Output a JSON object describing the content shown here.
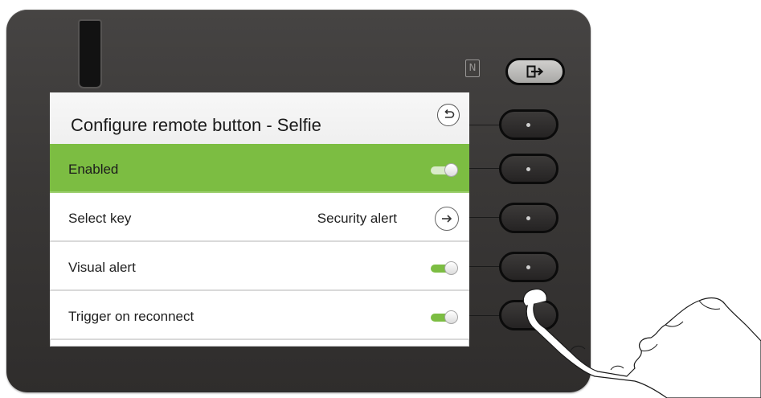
{
  "device": {
    "nfc_icon": "nfc-icon",
    "logout_icon": "logout-icon"
  },
  "screen": {
    "title": "Configure remote button - Selfie",
    "back_icon": "back-arrow-icon",
    "rows": [
      {
        "label": "Enabled",
        "type": "toggle",
        "on": true,
        "focused": true
      },
      {
        "label": "Select key",
        "type": "link",
        "value": "Security alert"
      },
      {
        "label": "Visual alert",
        "type": "toggle",
        "on": true
      },
      {
        "label": "Trigger on reconnect",
        "type": "toggle",
        "on": true
      }
    ]
  },
  "colors": {
    "focus_green": "#7cbd42",
    "body_dark": "#3a3837"
  }
}
